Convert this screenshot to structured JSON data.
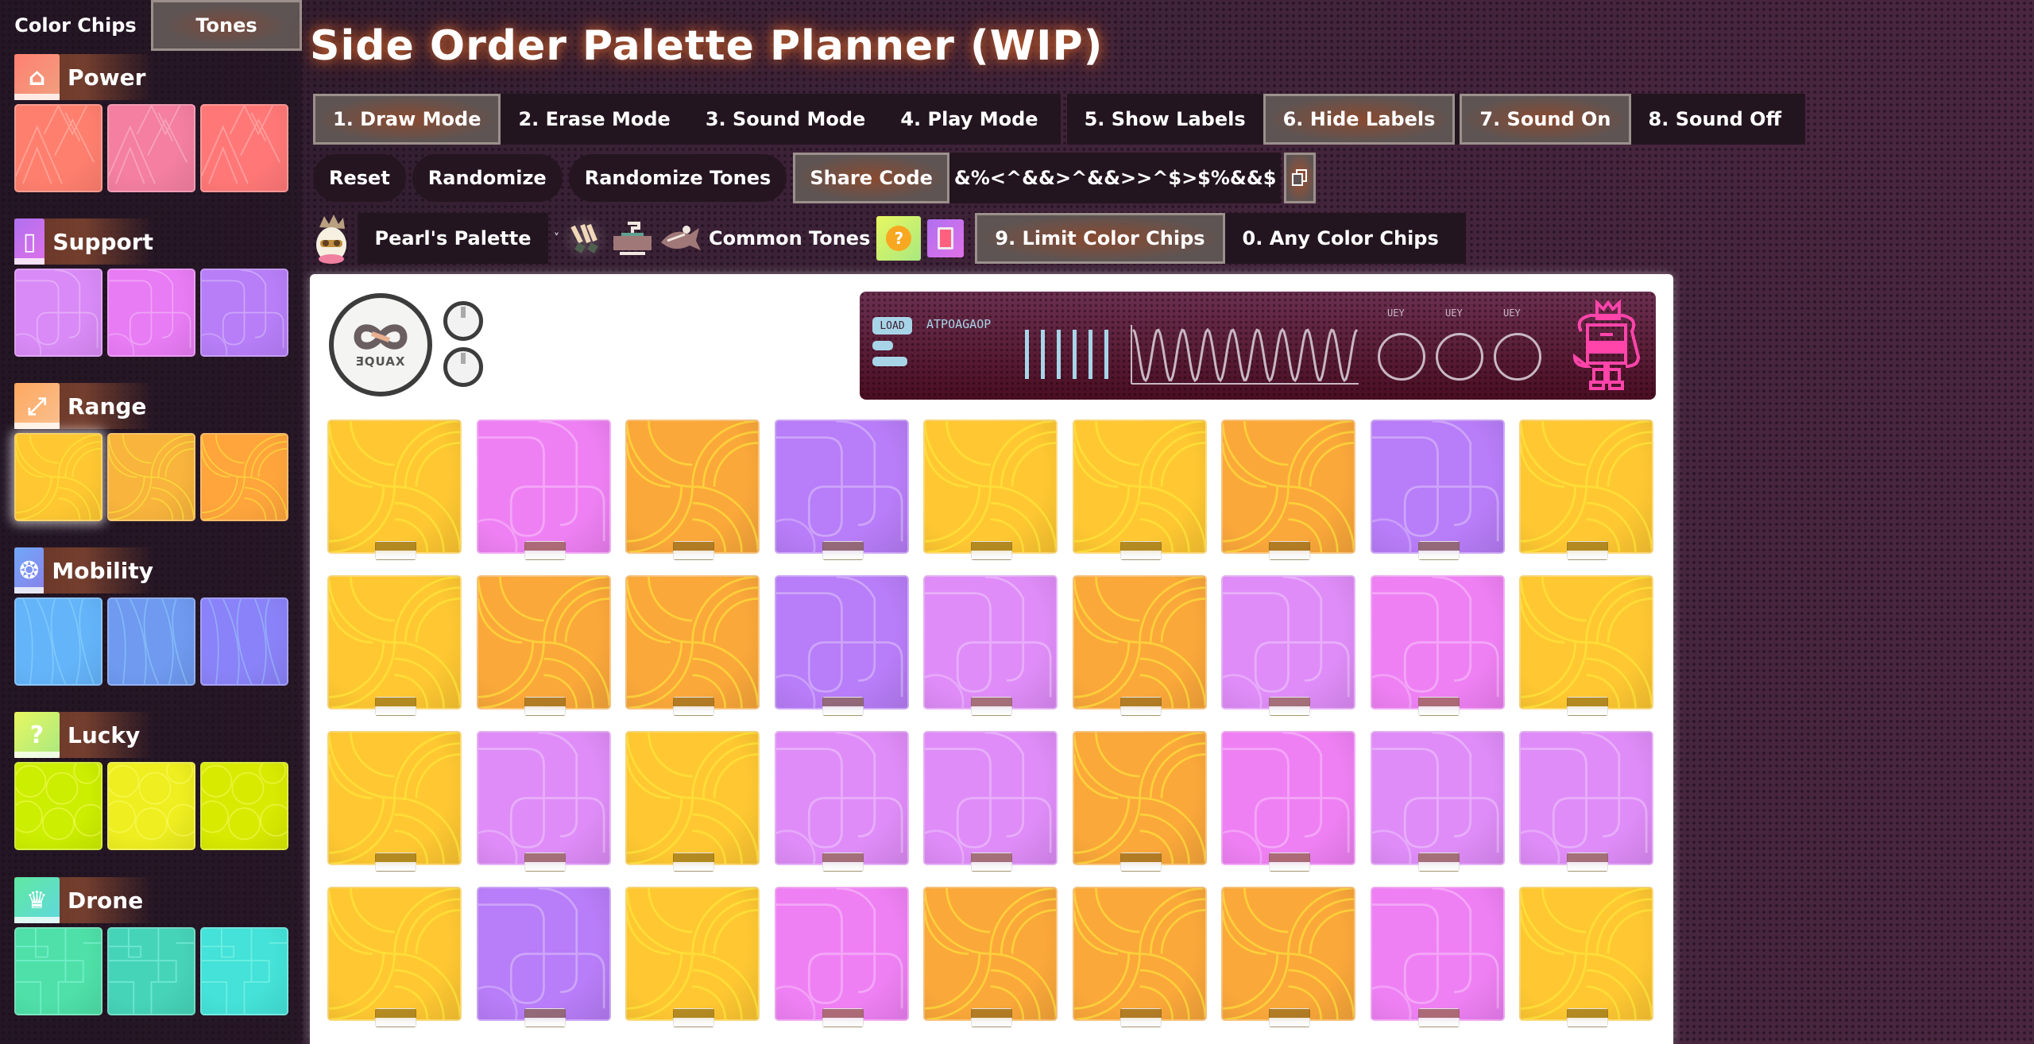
{
  "sidebar": {
    "tabs": [
      {
        "label": "Color Chips",
        "active": false
      },
      {
        "label": "Tones",
        "active": true
      }
    ],
    "categories": [
      {
        "name": "Power",
        "icon": "power-chip-icon",
        "colors": [
          "#ff7f6e",
          "#f47fa0",
          "#ff7877"
        ],
        "pattern": "zigzag",
        "selected": -1
      },
      {
        "name": "Support",
        "icon": "support-chip-icon",
        "colors": [
          "#d98af6",
          "#e87cf4",
          "#b77ef8"
        ],
        "pattern": "loops",
        "selected": -1
      },
      {
        "name": "Range",
        "icon": "range-chip-icon",
        "colors": [
          "#ffc832",
          "#f8b43c",
          "#ffa53c"
        ],
        "pattern": "arcs",
        "selected": 0
      },
      {
        "name": "Mobility",
        "icon": "mobility-chip-icon",
        "colors": [
          "#64b4fa",
          "#6f9af0",
          "#8a82f8"
        ],
        "pattern": "waves",
        "selected": -1
      },
      {
        "name": "Lucky",
        "icon": "lucky-chip-icon",
        "colors": [
          "#ccee00",
          "#eeee20",
          "#d8ea00"
        ],
        "pattern": "bubbles",
        "selected": -1
      },
      {
        "name": "Drone",
        "icon": "drone-chip-icon",
        "colors": [
          "#4ee0a8",
          "#46d4b8",
          "#44e2d8"
        ],
        "pattern": "squares",
        "selected": -1
      }
    ]
  },
  "header": {
    "title": "Side Order Palette Planner (WIP)"
  },
  "modes": [
    {
      "label": "1. Draw Mode",
      "active": true
    },
    {
      "label": "2. Erase Mode",
      "active": false
    },
    {
      "label": "3. Sound Mode",
      "active": false
    },
    {
      "label": "4. Play Mode",
      "active": false
    }
  ],
  "label_toggles": [
    {
      "label": "5. Show Labels",
      "active": false
    },
    {
      "label": "6. Hide Labels",
      "active": true
    },
    {
      "label": "7. Sound On",
      "active": true
    },
    {
      "label": "8. Sound Off",
      "active": false
    }
  ],
  "actions": {
    "reset": "Reset",
    "randomize": "Randomize",
    "randomize_tones": "Randomize Tones",
    "share_code": "Share Code",
    "share_code_value": "&%<^&&>^&&>>^$>$%&&$"
  },
  "palette": {
    "selected": "Pearl's Palette",
    "common_tones_label": "Common Tones",
    "weapon_icons": [
      "splatana-icon",
      "roller-icon",
      "fish-blaster-icon"
    ],
    "tone_cards": [
      "lucky-tone-icon",
      "support-tone-icon"
    ]
  },
  "chip_limits": [
    {
      "label": "9. Limit Color Chips",
      "active": true
    },
    {
      "label": "0. Any Color Chips",
      "active": false
    }
  ],
  "board": {
    "brand": "ƎQUAX",
    "screen": {
      "mode_pill": "LOAD",
      "text": "ATPOAGAOP",
      "circle_labels": [
        "UEY",
        "UEY",
        "UEY"
      ],
      "bar_count": 6
    },
    "palette_colors": {
      "Y": "#ffc832",
      "O": "#fba83a",
      "P": "#ef80f4",
      "L": "#df8cf8",
      "V": "#b87df8"
    },
    "rows": [
      [
        "Y",
        "P",
        "O",
        "V",
        "Y",
        "Y",
        "O",
        "V",
        "Y"
      ],
      [
        "Y",
        "O",
        "O",
        "V",
        "L",
        "O",
        "L",
        "P",
        "Y"
      ],
      [
        "Y",
        "L",
        "Y",
        "L",
        "L",
        "O",
        "P",
        "L",
        "L"
      ],
      [
        "Y",
        "V",
        "Y",
        "P",
        "O",
        "O",
        "O",
        "P",
        "Y"
      ]
    ]
  }
}
